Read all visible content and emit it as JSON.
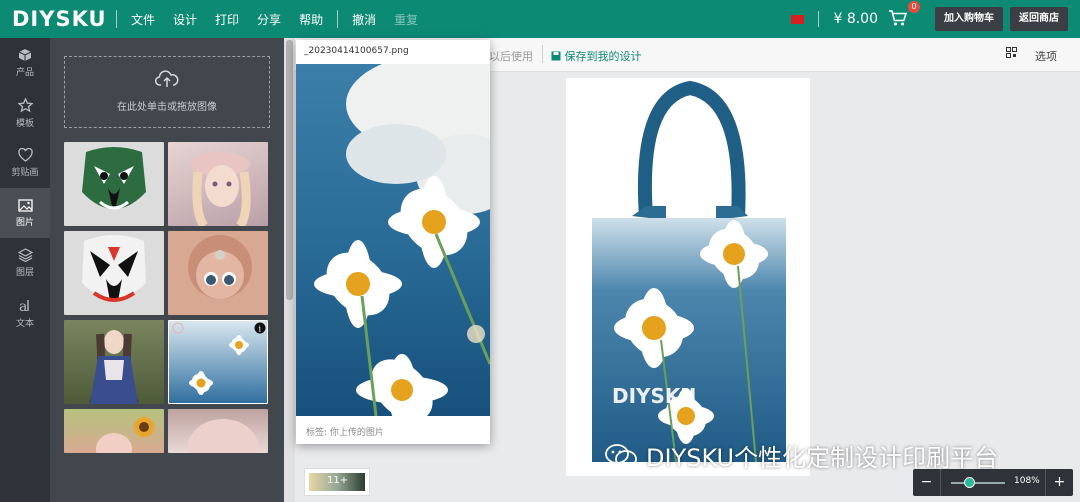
{
  "brand": {
    "logo": "DIYSKU"
  },
  "menu": [
    "文件",
    "设计",
    "打印",
    "分享",
    "帮助"
  ],
  "undo_label": "撤消",
  "redo_label": "重复",
  "header": {
    "price": "¥ 8.00",
    "cart_count": "0",
    "add_to_cart": "加入购物车",
    "back_to_store": "返回商店"
  },
  "rail": [
    {
      "label": "产品",
      "icon": "cube-icon"
    },
    {
      "label": "模板",
      "icon": "star-icon"
    },
    {
      "label": "剪贴画",
      "icon": "heart-icon"
    },
    {
      "label": "图片",
      "icon": "image-icon",
      "active": true
    },
    {
      "label": "图层",
      "icon": "layers-icon"
    },
    {
      "label": "文本",
      "icon": "text-icon"
    }
  ],
  "upload": {
    "label": "在此处单击或拖放图像"
  },
  "subbar": {
    "later": "以后使用",
    "save": "保存到我的设计",
    "options": "选项"
  },
  "popover": {
    "filename": "_20230414100657.png",
    "tags": "标签:  你上传的图片"
  },
  "canvas": {
    "bag_brand": "DIYSKU"
  },
  "swatch": {
    "count": "11+"
  },
  "zoom": {
    "value": "108%"
  },
  "watermark": {
    "text": "DIYSKU个性化定制设计印刷平台"
  },
  "colors": {
    "brand": "#0d8a74",
    "rail": "#2f3238",
    "panel": "#42464d"
  }
}
